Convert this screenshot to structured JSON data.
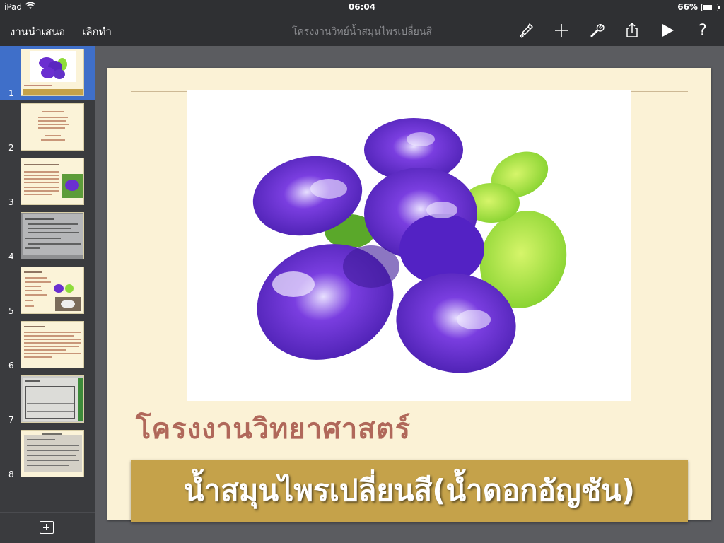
{
  "status_bar": {
    "device": "iPad",
    "time": "06:04",
    "battery": "66%",
    "battery_level": 0.66
  },
  "toolbar": {
    "presentations_label": "งานนำเสนอ",
    "undo_label": "เลิกทำ",
    "document_title": "โครงงานวิทย์น้ำสมุนไพรเปลี่ยนสี",
    "help_label": "?",
    "icons": [
      "paintbrush-icon",
      "plus-icon",
      "wrench-icon",
      "share-icon",
      "play-icon"
    ]
  },
  "sidebar": {
    "slides": [
      {
        "number": "1",
        "selected": true
      },
      {
        "number": "2",
        "selected": false
      },
      {
        "number": "3",
        "selected": false
      },
      {
        "number": "4",
        "selected": false
      },
      {
        "number": "5",
        "selected": false
      },
      {
        "number": "6",
        "selected": false
      },
      {
        "number": "7",
        "selected": false
      },
      {
        "number": "8",
        "selected": false
      }
    ]
  },
  "slide": {
    "title": "โครงงานวิทยาศาสตร์",
    "banner": "น้ำสมุนไพรเปลี่ยนสี(น้ำดอกอัญชัน)",
    "image": "butterfly-pea-flowers"
  },
  "colors": {
    "accent_selected": "#3f6fc9",
    "title_color": "#b0685a",
    "banner_color": "#c5a24a",
    "slide_bg": "#fbf2d6",
    "flower_purple": "#6a2fd0",
    "leaf_green": "#9fe03a"
  }
}
